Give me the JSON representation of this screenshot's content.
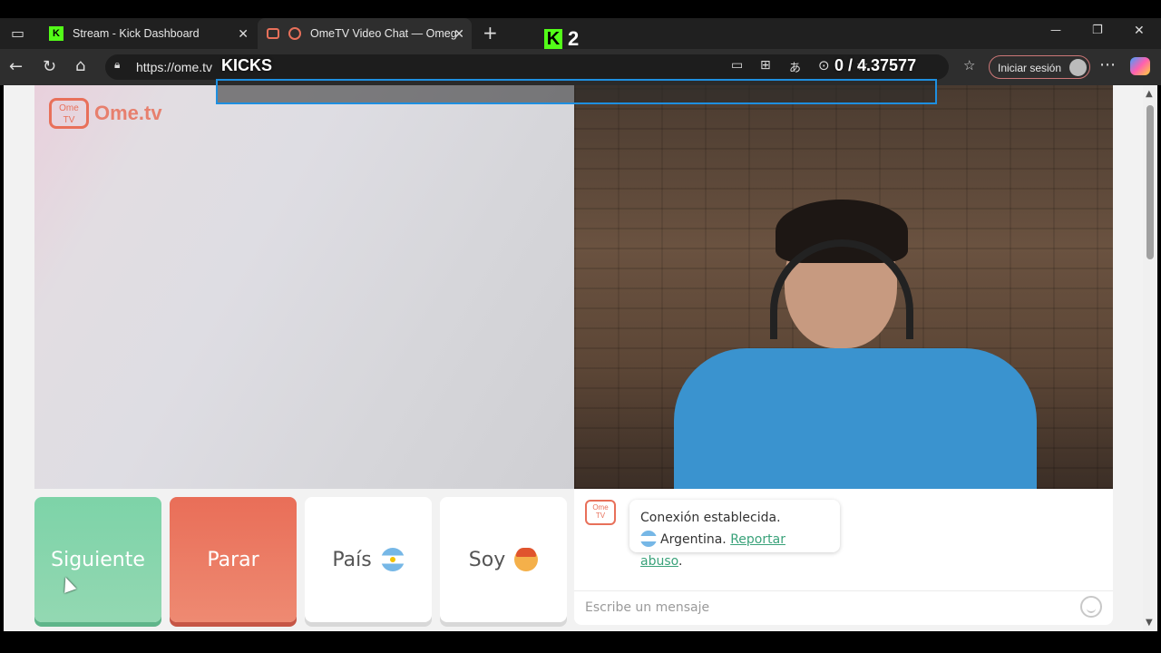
{
  "browser": {
    "tabs": [
      {
        "title": "Stream - Kick Dashboard",
        "close": "✕"
      },
      {
        "title": "OmeTV Video Chat — Omeg",
        "close": "✕"
      }
    ],
    "new_tab": "+",
    "url": "https://ome.tv",
    "signin_label": "Iniciar sesión",
    "window_controls": {
      "minimize": "—",
      "restore": "❐",
      "close": "✕"
    }
  },
  "overlays": {
    "kicks_label": "KICKS",
    "k_badge": "K",
    "k_count": "2",
    "stats_text": "0  / 4.37577"
  },
  "logo": {
    "tv_text": "Ome\nTV",
    "name": "Ome.tv"
  },
  "buttons": {
    "next": "Siguiente",
    "stop": "Parar",
    "country": "País",
    "soy": "Soy"
  },
  "chat": {
    "logo_text": "Ome TV",
    "message_line1": "Conexión establecida.",
    "country_name": "Argentina.",
    "report_link": "Reportar abuso",
    "period": ".",
    "input_placeholder": "Escribe un mensaje"
  },
  "colors": {
    "accent_green": "#7dd3a8",
    "accent_red": "#e96e58",
    "brand_orange": "#e8705a",
    "kick_green": "#53fc18"
  }
}
